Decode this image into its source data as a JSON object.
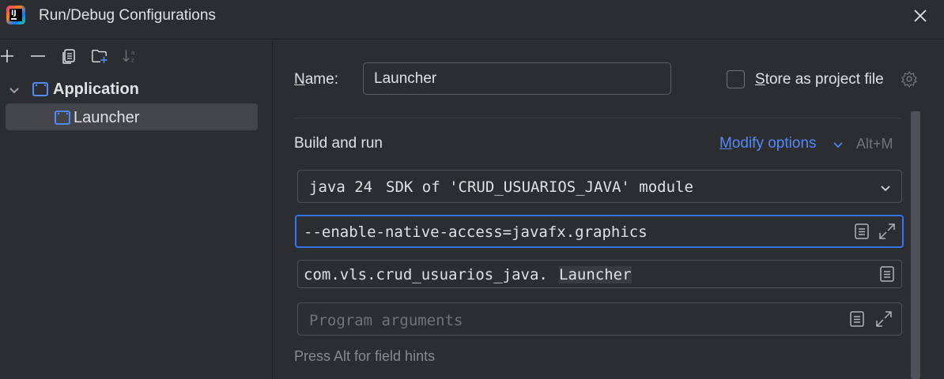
{
  "window": {
    "title": "Run/Debug Configurations"
  },
  "toolbar": {
    "icons": [
      "add-icon",
      "remove-icon",
      "copy-icon",
      "new-folder-icon",
      "sort-icon"
    ]
  },
  "tree": {
    "group_label": "Application",
    "items": [
      {
        "label": "Launcher",
        "selected": true
      }
    ]
  },
  "form": {
    "name_label": "Name:",
    "name_value": "Launcher",
    "store_label": "Store as project file",
    "store_checked": false,
    "section_title": "Build and run",
    "modify_options_label": "Modify options",
    "modify_options_shortcut": "Alt+M",
    "jdk_main": "java 24",
    "jdk_detail": "SDK of 'CRUD_USUARIOS_JAVA' module",
    "vm_options_value": "--enable-native-access=javafx.graphics",
    "main_class_prefix": "com.vls.crud_usuarios_java.",
    "main_class_name": "Launcher",
    "program_args_placeholder": "Program arguments",
    "field_hint": "Press Alt for field hints"
  },
  "colors": {
    "accent": "#548af7",
    "focus_border": "#3574f0",
    "background": "#2b2d30"
  }
}
